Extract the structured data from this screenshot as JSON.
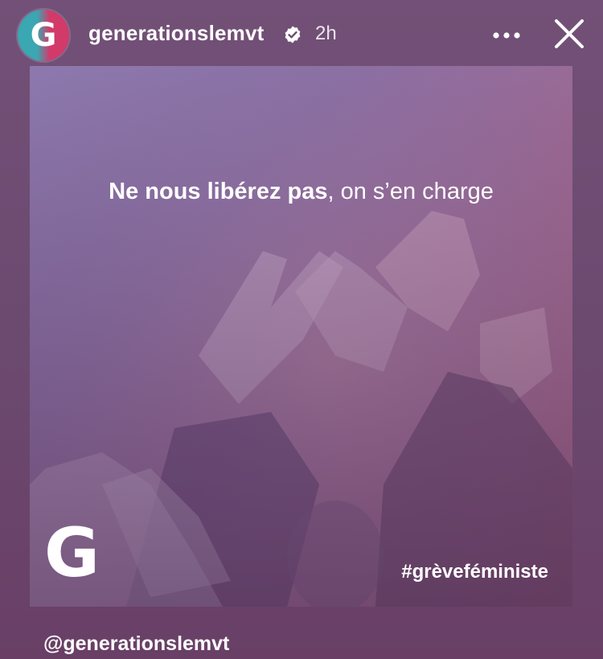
{
  "header": {
    "avatar_letter": "G",
    "username": "generationslemvt",
    "verified_icon": "verified-badge-icon",
    "time_ago": "2h",
    "more_icon": "more-horizontal-icon",
    "close_icon": "close-icon"
  },
  "post": {
    "headline_bold": "Ne nous libérez pas",
    "headline_rest": ", on s’en charge",
    "logo_letter": "G",
    "hashtag": "#grèveféministe"
  },
  "mention": "@generationslemvt",
  "colors": {
    "background": "#6e4a6e",
    "avatar_teal": "#3aa7b2",
    "avatar_pink": "#d23a6a",
    "post_gradient_start": "#8c79ad",
    "post_gradient_end": "#b4617f"
  }
}
